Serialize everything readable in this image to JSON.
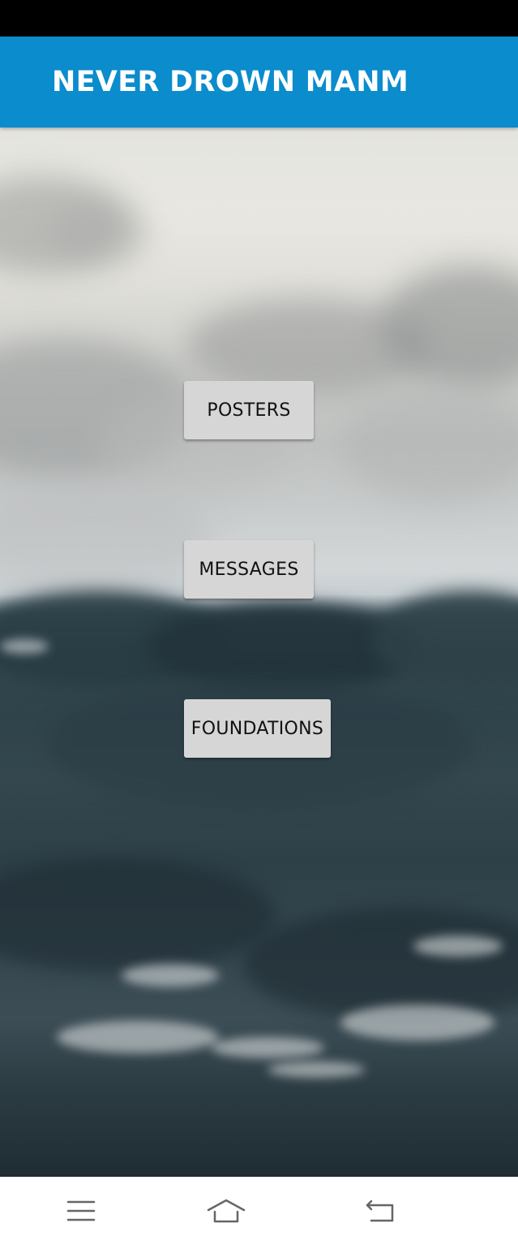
{
  "app_bar": {
    "title": "NEVER DROWN MANM",
    "color": "#0a8ccd"
  },
  "buttons": {
    "posters": "POSTERS",
    "messages": "MESSAGES",
    "foundations": "FOUNDATIONS"
  },
  "navigation_bar": {
    "items": [
      {
        "icon": "menu-icon"
      },
      {
        "icon": "home-icon"
      },
      {
        "icon": "back-icon"
      }
    ]
  },
  "background": {
    "scene": "stormy-sea-icon",
    "sky_color": "#e4e4df",
    "sea_color": "#2f434b"
  }
}
